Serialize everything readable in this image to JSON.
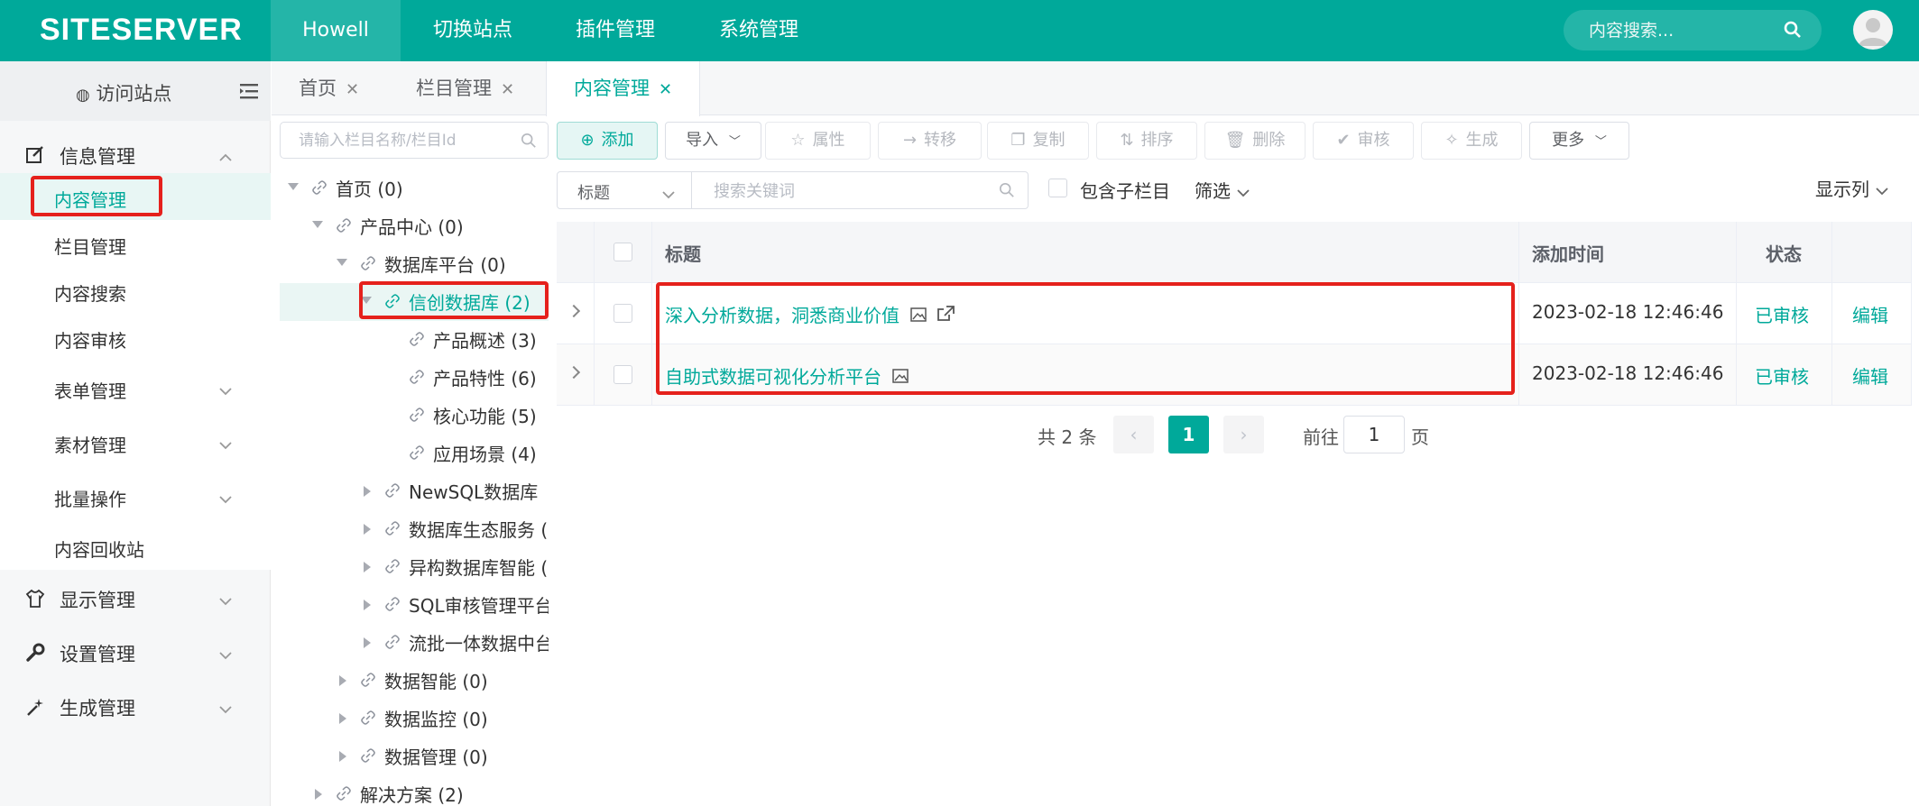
{
  "header": {
    "logo": "SITESERVER",
    "nav": [
      "Howell",
      "切换站点",
      "插件管理",
      "系统管理"
    ],
    "search_placeholder": "内容搜索...",
    "brand_color": "#00a99a"
  },
  "sidebar": {
    "visit_site": "访问站点",
    "sections": [
      {
        "label": "信息管理",
        "icon": "edit-icon",
        "expanded": true,
        "items": [
          {
            "label": "内容管理",
            "active": true
          },
          {
            "label": "栏目管理"
          },
          {
            "label": "内容搜索"
          },
          {
            "label": "内容审核"
          },
          {
            "label": "表单管理",
            "has_children": true
          },
          {
            "label": "素材管理",
            "has_children": true
          },
          {
            "label": "批量操作",
            "has_children": true
          },
          {
            "label": "内容回收站"
          }
        ]
      },
      {
        "label": "显示管理",
        "icon": "shirt-icon"
      },
      {
        "label": "设置管理",
        "icon": "wrench-icon"
      },
      {
        "label": "生成管理",
        "icon": "magic-wand-icon"
      }
    ]
  },
  "tabs": [
    {
      "label": "首页",
      "close": "✕"
    },
    {
      "label": "栏目管理",
      "close": "✕"
    },
    {
      "label": "内容管理",
      "close": "✕",
      "active": true
    }
  ],
  "tree": {
    "search_placeholder": "请输入栏目名称/栏目Id",
    "nodes": [
      {
        "label": "首页 (0)",
        "level": 0,
        "expanded": true
      },
      {
        "label": "产品中心 (0)",
        "level": 1,
        "expanded": true
      },
      {
        "label": "数据库平台 (0)",
        "level": 2,
        "expanded": true
      },
      {
        "label": "信创数据库 (2)",
        "level": 3,
        "expanded": true,
        "selected": true
      },
      {
        "label": "产品概述 (3)",
        "level": 4
      },
      {
        "label": "产品特性 (6)",
        "level": 4
      },
      {
        "label": "核心功能 (5)",
        "level": 4
      },
      {
        "label": "应用场景 (4)",
        "level": 4
      },
      {
        "label": "NewSQL数据库",
        "level": 3,
        "collapsed": true
      },
      {
        "label": "数据库生态服务 (",
        "level": 3,
        "collapsed": true
      },
      {
        "label": "异构数据库智能 (",
        "level": 3,
        "collapsed": true
      },
      {
        "label": "SQL审核管理平台",
        "level": 3,
        "collapsed": true
      },
      {
        "label": "流批一体数据中台",
        "level": 3,
        "collapsed": true
      },
      {
        "label": "数据智能 (0)",
        "level": 2,
        "collapsed": true
      },
      {
        "label": "数据监控 (0)",
        "level": 2,
        "collapsed": true
      },
      {
        "label": "数据管理 (0)",
        "level": 2,
        "collapsed": true
      },
      {
        "label": "解决方案 (2)",
        "level": 1,
        "collapsed": true
      }
    ]
  },
  "toolbar": {
    "add": "添加",
    "import": "导入",
    "attributes": "属性",
    "transfer": "转移",
    "copy": "复制",
    "sort": "排序",
    "delete": "删除",
    "audit": "审核",
    "generate": "生成",
    "more": "更多"
  },
  "filter": {
    "field_select": "标题",
    "keyword_placeholder": "搜索关键词",
    "include_children": "包含子栏目",
    "filter_label": "筛选",
    "show_columns": "显示列"
  },
  "table": {
    "columns": [
      "标题",
      "添加时间",
      "状态"
    ],
    "rows": [
      {
        "title": "深入分析数据，洞悉商业价值",
        "time": "2023-02-18 12:46:46",
        "status": "已审核",
        "action": "编辑",
        "has_image": true,
        "has_link": true
      },
      {
        "title": "自助式数据可视化分析平台",
        "time": "2023-02-18 12:46:46",
        "status": "已审核",
        "action": "编辑",
        "has_image": true,
        "has_link": false
      }
    ]
  },
  "pagination": {
    "total": "共 2 条",
    "current_page": "1",
    "goto_label": "前往",
    "goto_value": "1",
    "page_suffix": "页"
  }
}
